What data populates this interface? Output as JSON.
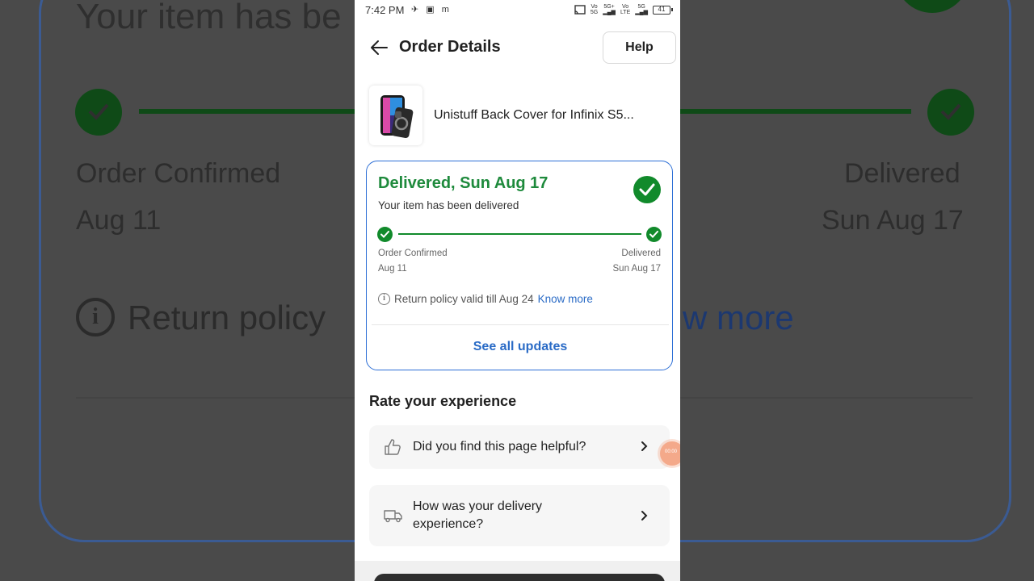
{
  "background": {
    "title_fragment": "Your item has be",
    "left_status": "Order Confirmed",
    "left_date": "Aug 11",
    "right_status": "Delivered",
    "right_date": "Sun Aug 17",
    "return_fragment": "Return policy",
    "know_fragment": "w more"
  },
  "status_bar": {
    "time": "7:42 PM",
    "app_icons": "✈ ▣ m",
    "net1_top": "Vo",
    "net1_bottom": "5G",
    "net2_top": "5G+",
    "net2_bottom": "",
    "net3_top": "Vo",
    "net3_bottom": "LTE",
    "net4_top": "5G",
    "net4_bottom": "",
    "battery": "41"
  },
  "header": {
    "title": "Order Details",
    "help_label": "Help"
  },
  "product": {
    "name": "Unistuff Back Cover for Infinix S5..."
  },
  "delivery": {
    "title": "Delivered, Sun Aug 17",
    "subtitle": "Your item has been delivered",
    "start_label": "Order Confirmed",
    "start_date": "Aug 11",
    "end_label": "Delivered",
    "end_date": "Sun Aug 17",
    "progress": 1.0,
    "return_text": "Return policy valid till Aug 24",
    "know_more": "Know more",
    "see_all": "See all updates"
  },
  "rate": {
    "title": "Rate your experience",
    "items": [
      {
        "label": "Did you find this page helpful?",
        "icon": "thumbs-up-icon"
      },
      {
        "label": "How was your delivery experience?",
        "icon": "truck-icon"
      }
    ]
  },
  "recorder": {
    "time": "00:00"
  },
  "colors": {
    "success": "#118a2b",
    "accent_blue": "#2a6bc6",
    "card_border": "#2d6fd6"
  }
}
